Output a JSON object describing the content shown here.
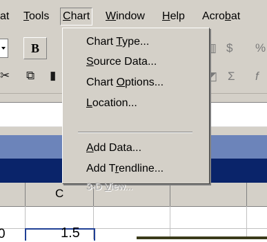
{
  "menubar": {
    "items": [
      {
        "label": "at",
        "underline_index": -1
      },
      {
        "label": "Tools",
        "underline_index": 0
      },
      {
        "label": "Chart",
        "underline_index": 0
      },
      {
        "label": "Window",
        "underline_index": 0
      },
      {
        "label": "Help",
        "underline_index": 0
      },
      {
        "label": "Acrobat",
        "underline_index": 4
      }
    ],
    "open_menu": "Chart"
  },
  "toolbar": {
    "bold_label": "B",
    "currency_symbol": "$",
    "percent_partial": "%",
    "sigma_symbol": "Σ",
    "fx_partial": "f"
  },
  "chart_menu": {
    "items": [
      {
        "label": "Chart Type...",
        "underline_index": 6,
        "enabled": true
      },
      {
        "label": "Source Data...",
        "underline_index": 0,
        "enabled": true
      },
      {
        "label": "Chart Options...",
        "underline_index": 6,
        "enabled": true
      },
      {
        "label": "Location...",
        "underline_index": 0,
        "enabled": true
      },
      {
        "label": "Add Data...",
        "underline_index": 0,
        "enabled": true
      },
      {
        "label": "Add Trendline...",
        "underline_index": 5,
        "enabled": true
      },
      {
        "label": "3-D View...",
        "underline_index": 4,
        "enabled": false
      }
    ]
  },
  "sheet": {
    "visible_column_label": "C",
    "active_cell_value": "1.5",
    "left_cell_partial": "0"
  },
  "colors": {
    "face": "#d4d0c8",
    "title_bar": "#0a246a",
    "active_cell_border": "#1f3f95"
  }
}
